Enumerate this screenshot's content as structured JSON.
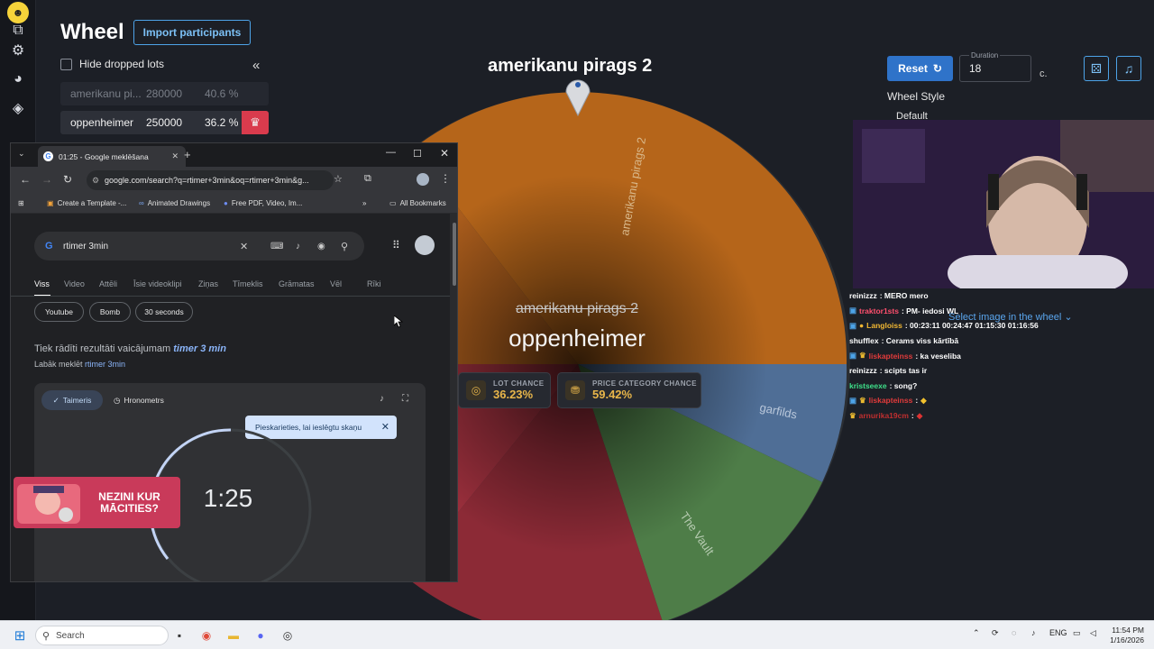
{
  "wheel_app": {
    "title": "Wheel",
    "import_label": "Import participants",
    "hide_dropped_label": "Hide dropped lots",
    "collapse_icon": "double-chevron-left-icon",
    "lots": [
      {
        "name": "amerikanu pi...",
        "amount": "280000",
        "percent": "40.6 %",
        "dropped": true
      },
      {
        "name": "oppenheimer",
        "amount": "250000",
        "percent": "36.2 %",
        "dropped": false
      }
    ],
    "wheel_title": "amerikanu pirags 2",
    "center_dropped": "amerikanu pirags 2",
    "center_current": "oppenheimer",
    "segments": [
      {
        "label": "amerikanu pirags 2",
        "color": "#b5651a"
      },
      {
        "label": "garfilds",
        "color": "#4f6e96"
      },
      {
        "label": "The Vault",
        "color": "#4e7d48"
      }
    ],
    "lot_chance_label": "LOT CHANCE",
    "lot_chance_value": "36.23%",
    "price_chance_label": "PRICE CATEGORY CHANCE",
    "price_chance_value": "59.42%",
    "reset_label": "Reset",
    "duration_label": "Duration",
    "duration_value": "18",
    "duration_unit": "c.",
    "wheel_style_label": "Wheel Style",
    "wheel_style_value": "Default",
    "select_image_label": "Select image in the wheel"
  },
  "chat": [
    {
      "user": "reinizzz",
      "text": ": MERO mero",
      "color": "#ffffff"
    },
    {
      "user": "traktor1sts",
      "text": ": PM- iedosi WL",
      "color": "#ff4f6d"
    },
    {
      "user": "Langloiss",
      "text": ": 00:23:11 00:24:47 01:15:30 01:16:56",
      "color": "#f2b833"
    },
    {
      "user": "shufflex",
      "text": ": Cerams viss kārtībā",
      "color": "#ffffff"
    },
    {
      "user": "liskapteinss",
      "text": ": ka veseliba",
      "color": "#e23b3b"
    },
    {
      "user": "reinizzz",
      "text": ": scipts tas ir",
      "color": "#ffffff"
    },
    {
      "user": "kristseexe",
      "text": ": song?",
      "color": "#3ee08a"
    },
    {
      "user": "liskapteinss",
      "text": ":",
      "color": "#e23b3b"
    },
    {
      "user": "arnurika19cm",
      "text": ":",
      "color": "#c02f2f"
    }
  ],
  "browser": {
    "tab_title": "01:25 - Google meklēšana",
    "url": "google.com/search?q=rtimer+3min&oq=rtimer+3min&g...",
    "bookmarks": [
      "Create a Template -...",
      "Animated Drawings",
      "Free PDF, Video, Im...",
      "All Bookmarks"
    ],
    "search_query": "rtimer 3min",
    "search_tabs": [
      "Viss",
      "Video",
      "Attēli",
      "Īsie videoklipi",
      "Ziņas",
      "Tīmeklis",
      "Grāmatas",
      "Vēl",
      "Rīki"
    ],
    "chips": [
      "Youtube",
      "Bomb",
      "30 seconds"
    ],
    "showing_results": "Tiek rādīti rezultāti vaicājumam",
    "showing_query": "timer 3 min",
    "better_search": "Labāk meklēt",
    "better_query": "rtimer 3min",
    "timer_tab": "Taimeris",
    "stopwatch_tab": "Hronometrs",
    "tooltip": "Pieskarieties, lai ieslēgtu skaņu",
    "timer_value": "1:25"
  },
  "banner": {
    "text": "NEZINI KUR MĀCITIES?"
  },
  "taskbar": {
    "search_label": "Search",
    "lang": "ENG",
    "time": "11:54 PM",
    "date": "1/16/2026"
  },
  "colors": {
    "accent": "#2f73c9",
    "drop": "#d93b4d",
    "chance": "#e9b64a"
  }
}
